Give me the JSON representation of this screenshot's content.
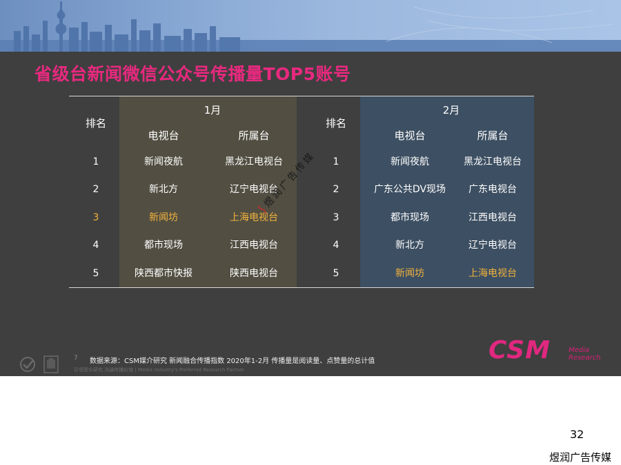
{
  "slide": {
    "title": "省级台新闻微信公众号传播量TOP5账号"
  },
  "table": {
    "rank_header": "排名",
    "months": [
      "1月",
      "2月"
    ],
    "col_station": "电视台",
    "col_affiliate": "所属台",
    "ranks": [
      "1",
      "2",
      "3",
      "4",
      "5"
    ],
    "jan_rows": [
      {
        "station": "新闻夜航",
        "affiliate": "黑龙江电视台"
      },
      {
        "station": "新北方",
        "affiliate": "辽宁电视台"
      },
      {
        "station": "新闻坊",
        "affiliate": "上海电视台"
      },
      {
        "station": "都市现场",
        "affiliate": "江西电视台"
      },
      {
        "station": "陕西都市快报",
        "affiliate": "陕西电视台"
      }
    ],
    "feb_rows": [
      {
        "station": "新闻夜航",
        "affiliate": "黑龙江电视台"
      },
      {
        "station": "广东公共DV现场",
        "affiliate": "广东电视台"
      },
      {
        "station": "都市现场",
        "affiliate": "江西电视台"
      },
      {
        "station": "新北方",
        "affiliate": "辽宁电视台"
      },
      {
        "station": "新闻坊",
        "affiliate": "上海电视台"
      }
    ],
    "highlight_color": "#f2b33d"
  },
  "watermark": "煜润广告传媒",
  "footer": {
    "slide_num": "7",
    "source": "数据来源：CSM媒介研究 新闻融合传播指数 2020年1-2月 传播量是阅读量、点赞量的总计值",
    "slogan": "引领受众研究 沟通传播价值 | Media Industry's Preferred Research Partner",
    "logo_text": "CSM",
    "logo_sub1": "Media",
    "logo_sub2": "Research"
  },
  "page_number": "32",
  "brand": "煜润广告传媒",
  "colors": {
    "slide_bg": "#3f3f3f",
    "title": "#e8297f",
    "jan_panel": "#524e42",
    "feb_panel": "#3d4f62",
    "banner": "#88a8d4"
  }
}
